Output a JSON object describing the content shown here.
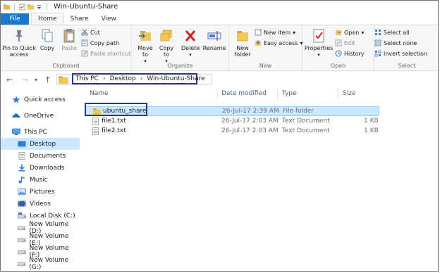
{
  "window": {
    "title": "Win-Ubuntu-Share"
  },
  "tabs": [
    {
      "label": "File"
    },
    {
      "label": "Home"
    },
    {
      "label": "Share"
    },
    {
      "label": "View"
    }
  ],
  "ribbon": {
    "clipboard": {
      "label": "Clipboard",
      "pin": "Pin to Quick access",
      "copy": "Copy",
      "paste": "Paste",
      "cut": "Cut",
      "copy_path": "Copy path",
      "paste_shortcut": "Paste shortcut"
    },
    "organize": {
      "label": "Organize",
      "move_to": "Move to",
      "copy_to": "Copy to",
      "delete": "Delete",
      "rename": "Rename"
    },
    "new": {
      "label": "New",
      "new_folder": "New folder",
      "new_item": "New item",
      "easy_access": "Easy access"
    },
    "open": {
      "label": "Open",
      "properties": "Properties",
      "open": "Open",
      "edit": "Edit",
      "history": "History"
    },
    "select": {
      "label": "Select",
      "select_all": "Select all",
      "select_none": "Select none",
      "invert": "Invert selection"
    }
  },
  "breadcrumb": [
    "This PC",
    "Desktop",
    "Win-Ubuntu-Share"
  ],
  "nav_pane": [
    {
      "label": "Quick access",
      "icon": "star-icon"
    },
    {
      "label": "OneDrive",
      "icon": "cloud-icon"
    },
    {
      "label": "This PC",
      "icon": "computer-icon"
    },
    {
      "label": "Desktop",
      "icon": "desktop-icon",
      "selected": true
    },
    {
      "label": "Documents",
      "icon": "documents-icon"
    },
    {
      "label": "Downloads",
      "icon": "download-icon"
    },
    {
      "label": "Music",
      "icon": "music-icon"
    },
    {
      "label": "Pictures",
      "icon": "pictures-icon"
    },
    {
      "label": "Videos",
      "icon": "videos-icon"
    },
    {
      "label": "Local Disk (C:)",
      "icon": "drive-icon"
    },
    {
      "label": "New Volume (D:)",
      "icon": "drive-icon"
    },
    {
      "label": "New Volume (E:)",
      "icon": "drive-icon"
    },
    {
      "label": "New Volume (F:)",
      "icon": "drive-icon"
    },
    {
      "label": "New Volume (G:)",
      "icon": "drive-icon"
    }
  ],
  "columns": {
    "name": "Name",
    "date": "Date modified",
    "type": "Type",
    "size": "Size"
  },
  "files": [
    {
      "name": "ubuntu_share",
      "date": "26-Jul-17 2:39 AM",
      "type": "File folder",
      "size": "",
      "icon": "folder-icon",
      "selected": true
    },
    {
      "name": "file1.txt",
      "date": "26-Jul-17 2:03 AM",
      "type": "Text Document",
      "size": "1 KB",
      "icon": "text-file-icon"
    },
    {
      "name": "file2.txt",
      "date": "26-Jul-17 2:03 AM",
      "type": "Text Document",
      "size": "1 KB",
      "icon": "text-file-icon"
    }
  ],
  "colors": {
    "accent": "#1979ca",
    "selection": "#cce8ff",
    "highlight_border": "#2b3590",
    "folder": "#e8b84a"
  }
}
